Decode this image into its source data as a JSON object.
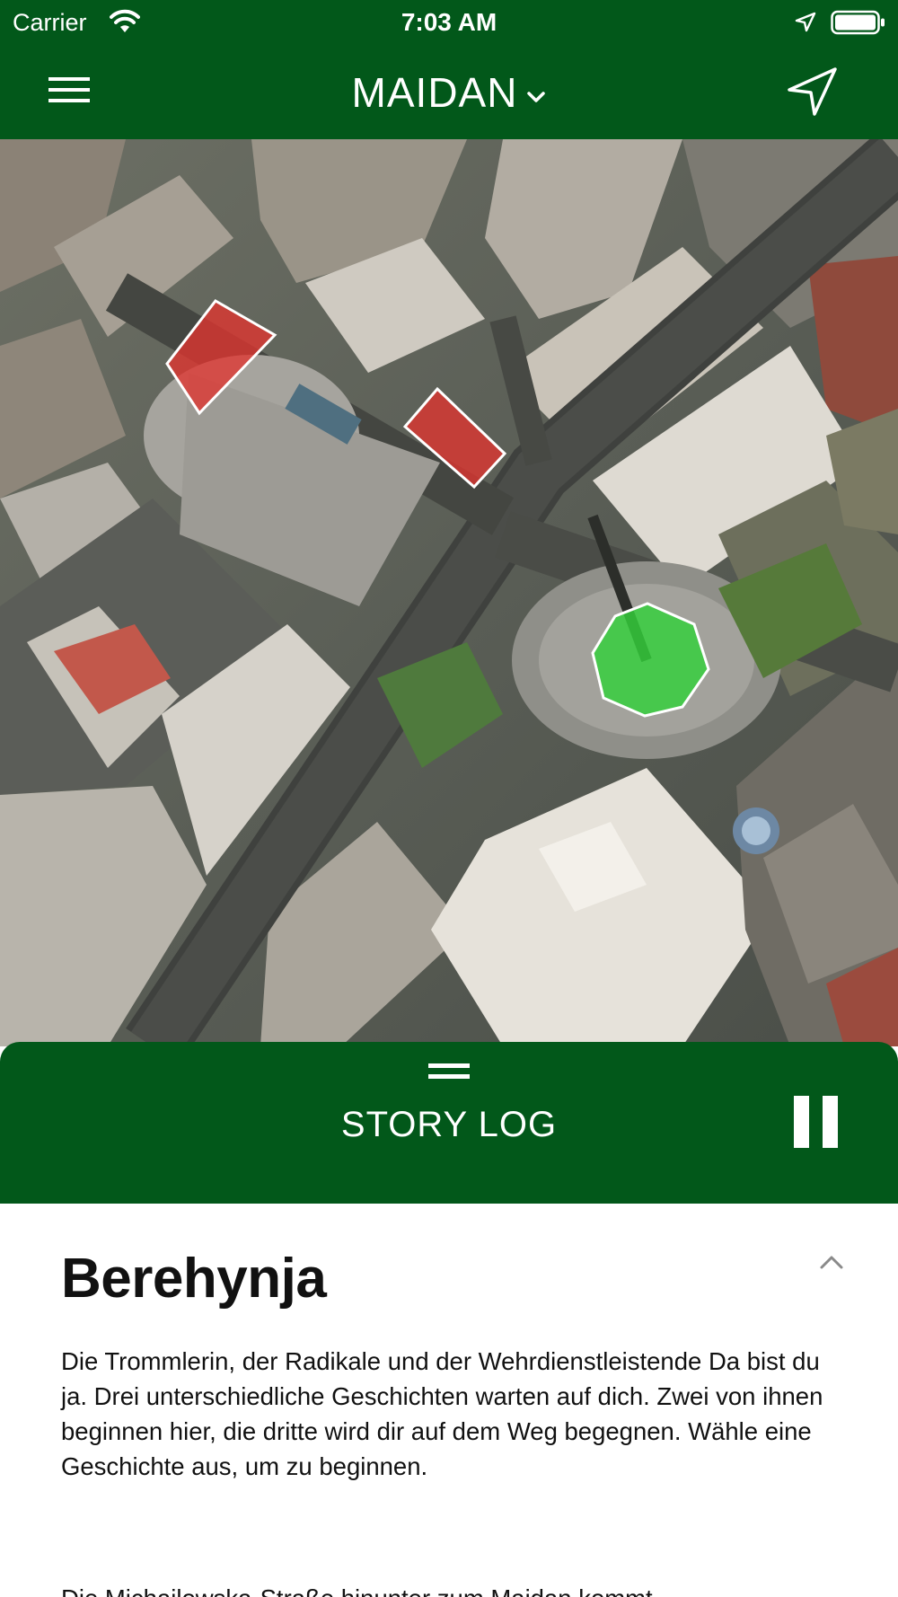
{
  "status_bar": {
    "carrier": "Carrier",
    "time": "7:03 AM",
    "icons": [
      "wifi-icon",
      "location-arrow-icon",
      "battery-icon"
    ]
  },
  "nav": {
    "title": "MAIDAN",
    "icons": [
      "hamburger-menu-icon",
      "chevron-down-icon",
      "navigation-arrow-icon"
    ]
  },
  "map": {
    "zones": [
      {
        "name": "zone-1",
        "state": "locked",
        "color": "#e0342f"
      },
      {
        "name": "zone-2",
        "state": "locked",
        "color": "#e0342f"
      },
      {
        "name": "zone-3",
        "state": "active",
        "color": "#33d13a"
      }
    ]
  },
  "story_log": {
    "label": "STORY LOG",
    "icons": [
      "drag-handle-icon",
      "pause-icon"
    ]
  },
  "story": {
    "title": "Berehynja",
    "paragraphs": [
      "Die Trommlerin, der Radikale und der Wehrdienstleistende Da bist du ja. Drei unterschiedliche Geschichten warten auf dich. Zwei von ihnen beginnen hier, die dritte wird dir auf dem Weg begegnen. Wähle eine Geschichte aus, um zu beginnen.",
      "Die Michailowska-Straße hinunter zum Maidan kommt"
    ]
  },
  "colors": {
    "brand_green": "#02581a",
    "zone_locked": "#e0342f",
    "zone_active": "#33d13a"
  }
}
